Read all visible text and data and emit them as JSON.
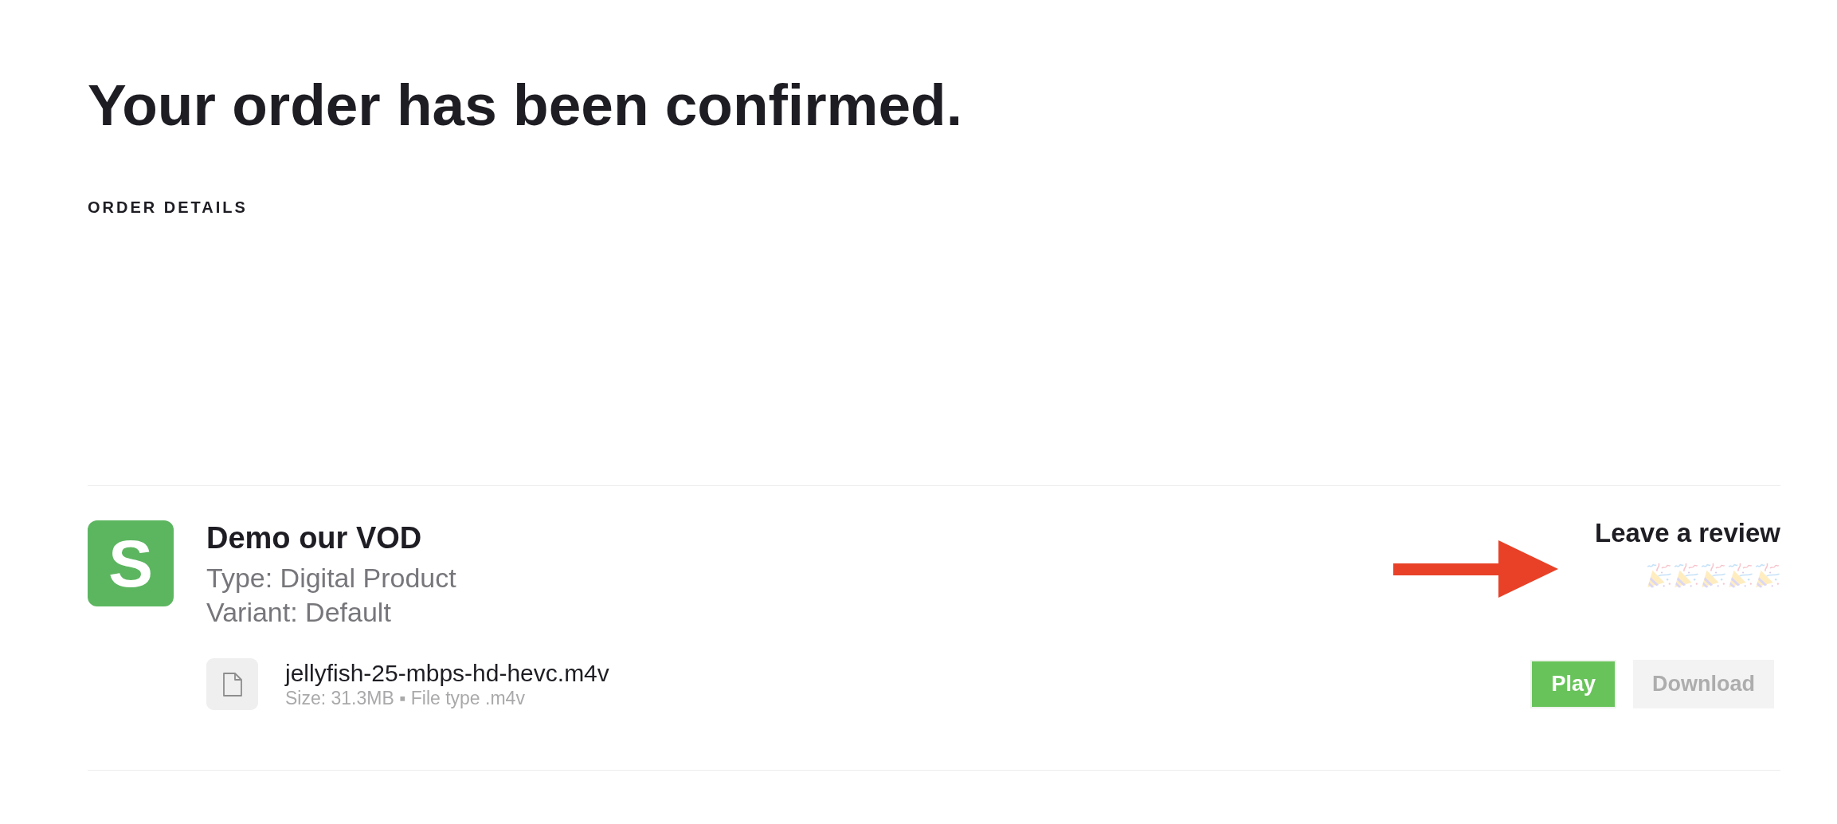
{
  "page": {
    "title": "Your order has been confirmed.",
    "section_heading": "ORDER DETAILS"
  },
  "order_item": {
    "logo_text": "S",
    "name": "Demo our VOD",
    "details": [
      "Type: Digital Product",
      "Variant: Default"
    ],
    "review": {
      "label": "Leave a review"
    },
    "file": {
      "name": "jellyfish-25-mbps-hd-hevc.m4v",
      "meta": "Size: 31.3MB ▪ File type .m4v"
    },
    "buttons": [
      {
        "label": "Play",
        "disabled": false
      },
      {
        "label": "Download",
        "disabled": true
      }
    ]
  }
}
